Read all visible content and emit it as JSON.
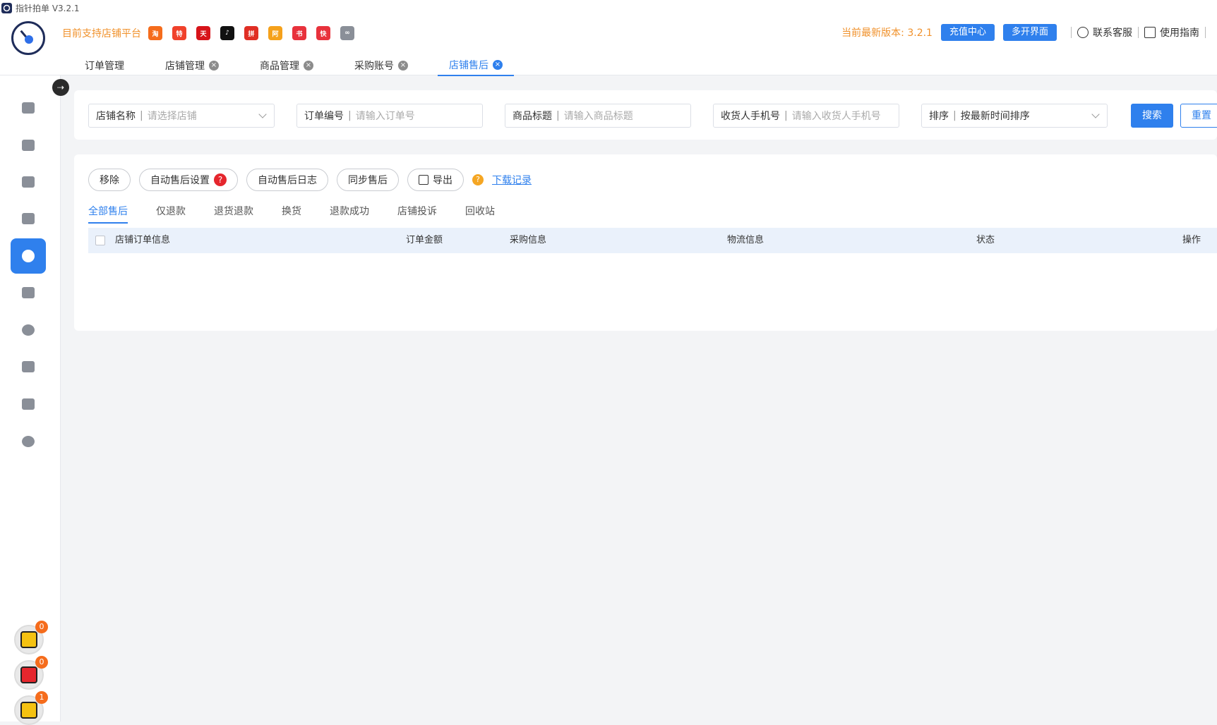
{
  "window": {
    "title": "指针拍单 V3.2.1"
  },
  "header": {
    "platforms_label": "目前支持店铺平台",
    "platforms": [
      {
        "name": "taobao-icon",
        "color": "#f56c1c",
        "text": "淘"
      },
      {
        "name": "tejia-icon",
        "color": "#f0412b",
        "text": "特"
      },
      {
        "name": "tmall-icon",
        "color": "#d7141a",
        "text": "天"
      },
      {
        "name": "douyin-icon",
        "color": "#111111",
        "text": "♪"
      },
      {
        "name": "pinduoduo-icon",
        "color": "#e02e24",
        "text": "拼"
      },
      {
        "name": "alibaba-icon",
        "color": "#f5a11b",
        "text": "阿"
      },
      {
        "name": "xiaohongshu-icon",
        "color": "#e8323c",
        "text": "书"
      },
      {
        "name": "kuaishou-icon",
        "color": "#e8323c",
        "text": "快"
      },
      {
        "name": "other-platform-icon",
        "color": "#8a8f98",
        "text": "∞"
      }
    ],
    "version_label": "当前最新版本: 3.2.1",
    "recharge_label": "充值中心",
    "multi_window_label": "多开界面",
    "support_label": "联系客服",
    "guide_label": "使用指南"
  },
  "tabs": [
    {
      "label": "订单管理",
      "closable": false,
      "active": false
    },
    {
      "label": "店铺管理",
      "closable": true,
      "active": false
    },
    {
      "label": "商品管理",
      "closable": true,
      "active": false
    },
    {
      "label": "采购账号",
      "closable": true,
      "active": false
    },
    {
      "label": "店铺售后",
      "closable": true,
      "active": true
    }
  ],
  "search": {
    "shop": {
      "label": "店铺名称",
      "placeholder": "请选择店铺"
    },
    "order": {
      "label": "订单编号",
      "placeholder": "请输入订单号"
    },
    "title": {
      "label": "商品标题",
      "placeholder": "请输入商品标题"
    },
    "phone": {
      "label": "收货人手机号",
      "placeholder": "请输入收货人手机号"
    },
    "sort": {
      "label": "排序",
      "value": "按最新时间排序"
    },
    "search_label": "搜索",
    "reset_label": "重置"
  },
  "actions": {
    "remove": "移除",
    "auto_settings": "自动售后设置",
    "auto_log": "自动售后日志",
    "sync": "同步售后",
    "export": "导出",
    "download_records": "下载记录"
  },
  "subtabs": [
    "全部售后",
    "仅退款",
    "退货退款",
    "换货",
    "退款成功",
    "店铺投诉",
    "回收站"
  ],
  "table": {
    "headers": [
      "店铺订单信息",
      "订单金额",
      "采购信息",
      "物流信息",
      "状态",
      "操作"
    ]
  },
  "float_badges": [
    "0",
    "0",
    "1"
  ],
  "colors": {
    "accent": "#2f80ed",
    "warning": "#f0912b",
    "badge": "#f56c1c"
  }
}
